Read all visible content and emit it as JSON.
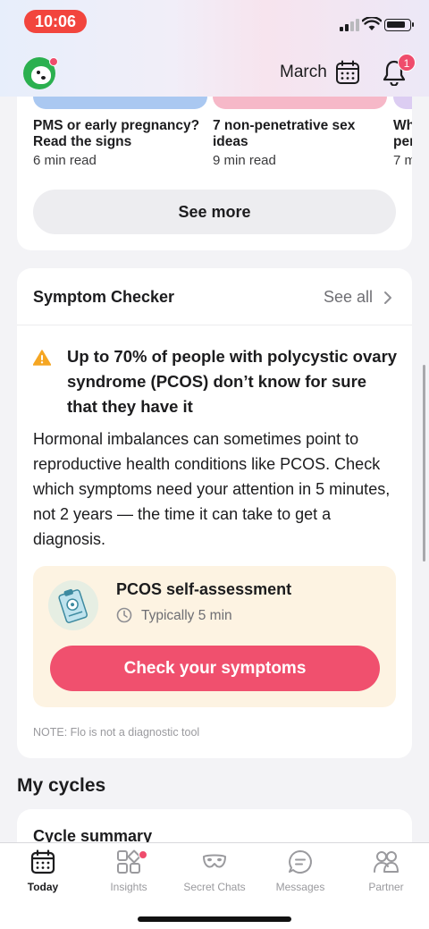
{
  "status_bar": {
    "time": "10:06"
  },
  "header": {
    "month": "March",
    "notification_count": "1"
  },
  "articles": [
    {
      "title": "PMS or early pregnancy? Read the signs",
      "meta": "6 min read",
      "color": "#aac8f1"
    },
    {
      "title": "7 non-penetrative sex ideas",
      "meta": "9 min read",
      "color": "#f6b8c8"
    },
    {
      "title": "Wh per",
      "meta": "7 m",
      "color": "#dccdf2"
    }
  ],
  "see_more": "See more",
  "symptom_checker": {
    "title": "Symptom Checker",
    "see_all": "See all",
    "warning": "Up to 70% of people with polycystic ovary syndrome (PCOS) don’t know for sure that they have it",
    "body": "Hormonal imbalances can sometimes point to reproductive health conditions like PCOS. Check which symptoms need your attention in 5 minutes, not 2 years — the time it can take to get a diagnosis.",
    "assessment_title": "PCOS self-assessment",
    "assessment_time": "Typically 5 min",
    "cta": "Check your symptoms",
    "note": "NOTE: Flo is not a diagnostic tool"
  },
  "my_cycles": {
    "heading": "My cycles",
    "card_title": "Cycle summary"
  },
  "tabs": [
    {
      "label": "Today"
    },
    {
      "label": "Insights"
    },
    {
      "label": "Secret Chats"
    },
    {
      "label": "Messages"
    },
    {
      "label": "Partner"
    }
  ],
  "colors": {
    "accent": "#f0506e",
    "badge": "#ef4c6c",
    "assessment_bg": "#fdf3e2"
  }
}
